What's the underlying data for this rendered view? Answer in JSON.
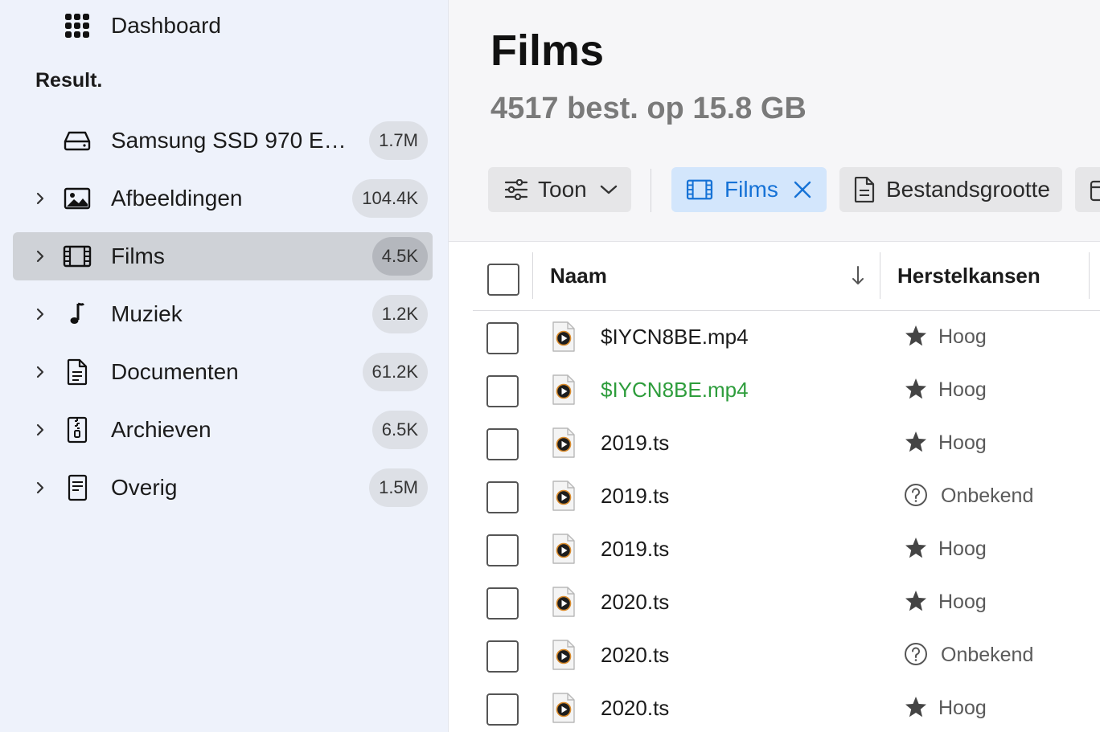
{
  "sidebar": {
    "dashboard_label": "Dashboard",
    "section_title": "Result.",
    "items": [
      {
        "label": "Samsung SSD 970 EVO...",
        "count": "1.7M",
        "icon": "drive-icon",
        "expandable": false
      },
      {
        "label": "Afbeeldingen",
        "count": "104.4K",
        "icon": "image-icon",
        "expandable": true
      },
      {
        "label": "Films",
        "count": "4.5K",
        "icon": "film-icon",
        "expandable": true,
        "selected": true
      },
      {
        "label": "Muziek",
        "count": "1.2K",
        "icon": "music-note-icon",
        "expandable": true
      },
      {
        "label": "Documenten",
        "count": "61.2K",
        "icon": "document-icon",
        "expandable": true
      },
      {
        "label": "Archieven",
        "count": "6.5K",
        "icon": "archive-icon",
        "expandable": true
      },
      {
        "label": "Overig",
        "count": "1.5M",
        "icon": "other-file-icon",
        "expandable": true
      }
    ]
  },
  "main": {
    "title": "Films",
    "subtitle": "4517 best. op 15.8 GB",
    "toolbar": {
      "show_label": "Toon",
      "active_filter_label": "Films",
      "filesize_label": "Bestandsgrootte"
    },
    "table": {
      "columns": [
        "Naam",
        "Herstelkansen"
      ],
      "sort": "descending",
      "rows": [
        {
          "name": "$IYCN8BE.mp4",
          "chance": "Hoog",
          "icon": "star-icon",
          "highlight": false
        },
        {
          "name": "$IYCN8BE.mp4",
          "chance": "Hoog",
          "icon": "star-icon",
          "highlight": true
        },
        {
          "name": "2019.ts",
          "chance": "Hoog",
          "icon": "star-icon",
          "highlight": false
        },
        {
          "name": "2019.ts",
          "chance": "Onbekend",
          "icon": "question-icon",
          "highlight": false
        },
        {
          "name": "2019.ts",
          "chance": "Hoog",
          "icon": "star-icon",
          "highlight": false
        },
        {
          "name": "2020.ts",
          "chance": "Hoog",
          "icon": "star-icon",
          "highlight": false
        },
        {
          "name": "2020.ts",
          "chance": "Onbekend",
          "icon": "question-icon",
          "highlight": false
        },
        {
          "name": "2020.ts",
          "chance": "Hoog",
          "icon": "star-icon",
          "highlight": false
        }
      ]
    }
  },
  "colors": {
    "sidebar_bg": "#eef2fb",
    "selected_bg": "#cfd2d7",
    "accent_blue": "#1672d6",
    "chip_active_bg": "#d3e6fc",
    "highlight_green": "#2e9d3c"
  }
}
